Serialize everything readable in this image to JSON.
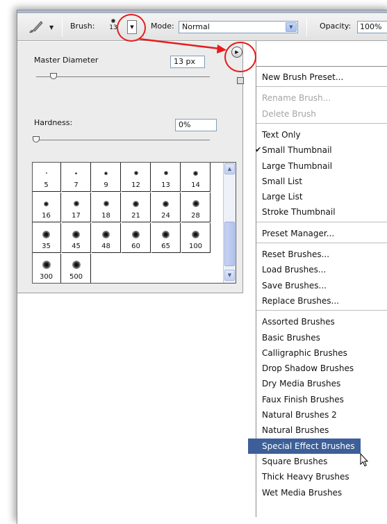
{
  "options_bar": {
    "brush_label": "Brush:",
    "brush_size": "13",
    "mode_label": "Mode:",
    "mode_value": "Normal",
    "opacity_label": "Opacity:",
    "opacity_value": "100%"
  },
  "picker": {
    "master_diameter_label": "Master Diameter",
    "master_diameter_value": "13 px",
    "master_diameter_slider": 0.1,
    "hardness_label": "Hardness:",
    "hardness_value": "0%",
    "hardness_slider": 0.0,
    "presets": [
      {
        "size": "5"
      },
      {
        "size": "7"
      },
      {
        "size": "9"
      },
      {
        "size": "12"
      },
      {
        "size": "13"
      },
      {
        "size": "14"
      },
      {
        "size": "16"
      },
      {
        "size": "17"
      },
      {
        "size": "18"
      },
      {
        "size": "21"
      },
      {
        "size": "24"
      },
      {
        "size": "28"
      },
      {
        "size": "35"
      },
      {
        "size": "45"
      },
      {
        "size": "48"
      },
      {
        "size": "60"
      },
      {
        "size": "65"
      },
      {
        "size": "100"
      },
      {
        "size": "300"
      },
      {
        "size": "500"
      }
    ]
  },
  "menu": {
    "groups": [
      [
        "New Brush Preset..."
      ],
      [
        "Rename Brush...",
        "Delete Brush"
      ],
      [
        "Text Only",
        "Small Thumbnail",
        "Large Thumbnail",
        "Small List",
        "Large List",
        "Stroke Thumbnail"
      ],
      [
        "Preset Manager..."
      ],
      [
        "Reset Brushes...",
        "Load Brushes...",
        "Save Brushes...",
        "Replace Brushes..."
      ],
      [
        "Assorted Brushes",
        "Basic Brushes",
        "Calligraphic Brushes",
        "Drop Shadow Brushes",
        "Dry Media Brushes",
        "Faux Finish Brushes",
        "Natural Brushes 2",
        "Natural Brushes",
        "Special Effect Brushes",
        "Square Brushes",
        "Thick Heavy Brushes",
        "Wet Media Brushes"
      ]
    ],
    "disabled": [
      "Rename Brush...",
      "Delete Brush"
    ],
    "checked": "Small Thumbnail",
    "highlighted": "Special Effect Brushes"
  },
  "colors": {
    "annotation": "#e61c1c",
    "menu_highlight": "#3d5f99"
  }
}
